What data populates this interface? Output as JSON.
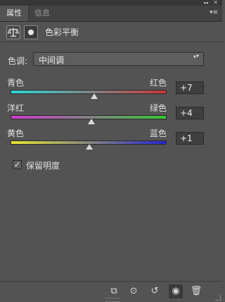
{
  "window": {
    "collapse_glyph": "◂◂",
    "close_glyph": "✕"
  },
  "tabs": [
    {
      "label": "属性",
      "active": true
    },
    {
      "label": "信息",
      "active": false
    }
  ],
  "panel_menu_glyph": "▾≡",
  "header": {
    "title": "色彩平衡",
    "icons": [
      "balance-scale-icon",
      "layer-mask-icon"
    ]
  },
  "tone": {
    "label": "色调:",
    "selected": "中间调",
    "caret": "▴▾"
  },
  "sliders": [
    {
      "left": "青色",
      "right": "红色",
      "value": 7,
      "display": "+7",
      "min": -100,
      "max": 100,
      "gradient": [
        "#2fd6d6",
        "#c93737"
      ]
    },
    {
      "left": "洋红",
      "right": "绿色",
      "value": 4,
      "display": "+4",
      "min": -100,
      "max": 100,
      "gradient": [
        "#d33ad3",
        "#36c936"
      ]
    },
    {
      "left": "黄色",
      "right": "蓝色",
      "value": 1,
      "display": "+1",
      "min": -100,
      "max": 100,
      "gradient": [
        "#e6e630",
        "#2626cf"
      ]
    }
  ],
  "preserve_luminosity": {
    "label": "保留明度",
    "checked": true,
    "check_glyph": "✓"
  },
  "footer": {
    "buttons": [
      {
        "name": "clip-to-layer-icon",
        "glyph": "⧉"
      },
      {
        "name": "view-previous-icon",
        "glyph": "⊙"
      },
      {
        "name": "reset-icon",
        "glyph": "↺"
      },
      {
        "name": "visibility-eye-icon",
        "glyph": "◉"
      },
      {
        "name": "trash-icon",
        "glyph": "🗑"
      }
    ]
  }
}
